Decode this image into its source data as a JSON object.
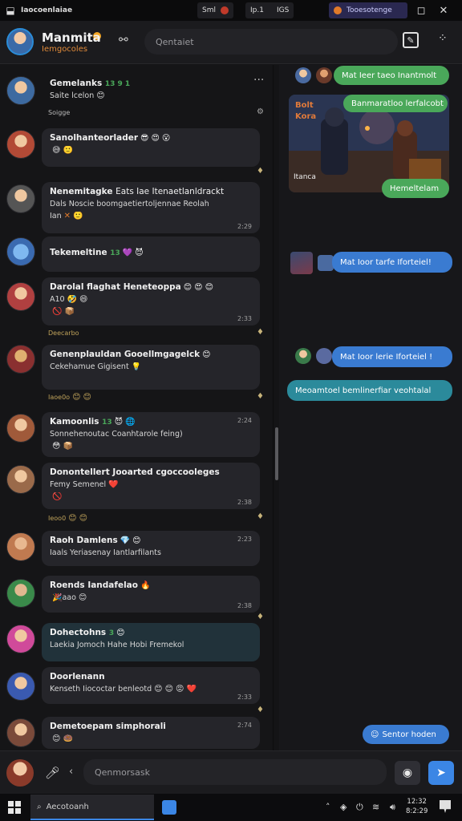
{
  "titlebar": {
    "app_name": "Iaocoenlaiae",
    "chip1_text": "Sml",
    "chip2_text": "Ip.1",
    "chip3_text": "IGS",
    "active_chip": "Tooesotenge",
    "restore_icon": "square",
    "close_icon": "✕"
  },
  "header": {
    "name": "Manmita",
    "subname": "Iemgocoles",
    "search_placeholder": "Qentaiet"
  },
  "conversations": [
    {
      "title": "Gemelanks",
      "badges": "13 9 1",
      "text": "Saite lcelon",
      "meta": "Soigge",
      "color": "#3d6aa0"
    },
    {
      "title": "Sanolhanteorlader",
      "text": "",
      "time": "",
      "color": "#b24a36"
    },
    {
      "title": "Nenemitagke",
      "line1": "Eats Iae Itenaetlanldrackt",
      "line2": "Dals Noscie boomgaetiertoljennae Reolah",
      "line3": "Ian",
      "time": "2:29",
      "color": "#8a8a8a"
    },
    {
      "title": "Tekemeltine",
      "badges": "13",
      "color": "#3a6ab0"
    },
    {
      "title": "Darolal flaghat Heneteoppa",
      "text": "A10",
      "time": "2:33",
      "meta": "Deecarbo",
      "color": "#b04040"
    },
    {
      "title": "Genenplauldan Gooellmgagelck",
      "text": "Cekehamue Gigisent",
      "meta": "Iaoe0o",
      "color": "#8a3030"
    },
    {
      "title": "Kamoonlis",
      "badges": "13",
      "text": "Sonnehenoutac Coanhtarole feing)",
      "time": "2:24",
      "color": "#a05a3a"
    },
    {
      "title": "Donontellert Jooarted cgoccooleges",
      "text": "Femy Semenel",
      "time": "2:38",
      "meta": "Ieoo0",
      "color": "#9a6a4a"
    },
    {
      "title": "Raoh Damlens",
      "text": "Iaals Yeriasenay Iantlarfilants",
      "time": "2:23",
      "color": "#c07a50"
    },
    {
      "title": "Roends Iandafelao",
      "text": "aao",
      "time": "2:38",
      "color": "#3a8a4a"
    },
    {
      "title": "Dohectohns",
      "badges": "3",
      "text": "Laekia Jomoch Hahe Hobi Fremekol",
      "time": "",
      "color": "#d04a9a"
    },
    {
      "title": "Doorlenann",
      "text": "Kenseth Iiococtar benleotd",
      "time": "2:33",
      "color": "#3a5ab0"
    },
    {
      "title": "Demetoepam simphorali",
      "time": "2:74",
      "color": "#7a4a3a"
    }
  ],
  "right_messages": [
    {
      "text": "Mat Ieer taeo Inantmolt",
      "style": "green"
    },
    {
      "text": "Banmaratloo lerfalcobt",
      "style": "green"
    },
    {
      "text": "Hemeltelam",
      "style": "green"
    },
    {
      "text": "Mat Ioor tarfe Iforteiel!",
      "style": "blue"
    },
    {
      "text": "Mat Ioor lerie Iforteiel !",
      "style": "blue"
    },
    {
      "text": "Meoamtoel bemlinerfiar veohtalal",
      "style": "teal"
    },
    {
      "text": "Sentor hoden",
      "style": "blue"
    }
  ],
  "game_card": {
    "overlay_top": "Bolt",
    "overlay_mid": "Kora",
    "overlay_bottom": "Itanca"
  },
  "composer": {
    "placeholder": "Qenmorsask"
  },
  "taskbar": {
    "search_text": "Aecotoanh",
    "time": "12:32",
    "date": "8:2:29"
  },
  "colors": {
    "accent": "#3b86e5",
    "green_bubble": "#4aa85a",
    "blue_bubble": "#3a7bd1",
    "teal_bubble": "#2b8a9b",
    "online_status": "#f5a623"
  },
  "icons": [
    "app-icon",
    "link-icon",
    "new-chat-icon",
    "more-icon",
    "mic-icon",
    "camera-icon",
    "send-icon",
    "windows-start-icon",
    "search-icon",
    "notification-icon"
  ]
}
